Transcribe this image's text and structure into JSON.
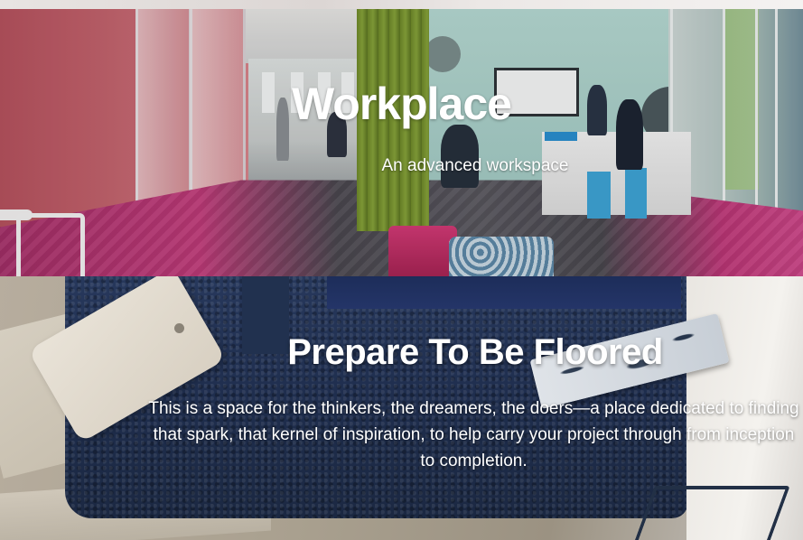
{
  "hero": {
    "title": "Workplace",
    "subtitle": "An advanced workspace"
  },
  "floored": {
    "title": "Prepare To Be Floored",
    "body": "This is a space for the thinkers, the dreamers, the doers—a place dedicated to finding that spark, that kernel of inspiration, to help carry your project through from inception to completion."
  },
  "colors": {
    "hero_text": "#ffffff",
    "carpet_navy": "#1f2e4e",
    "floor_magenta": "#c43c7c"
  }
}
